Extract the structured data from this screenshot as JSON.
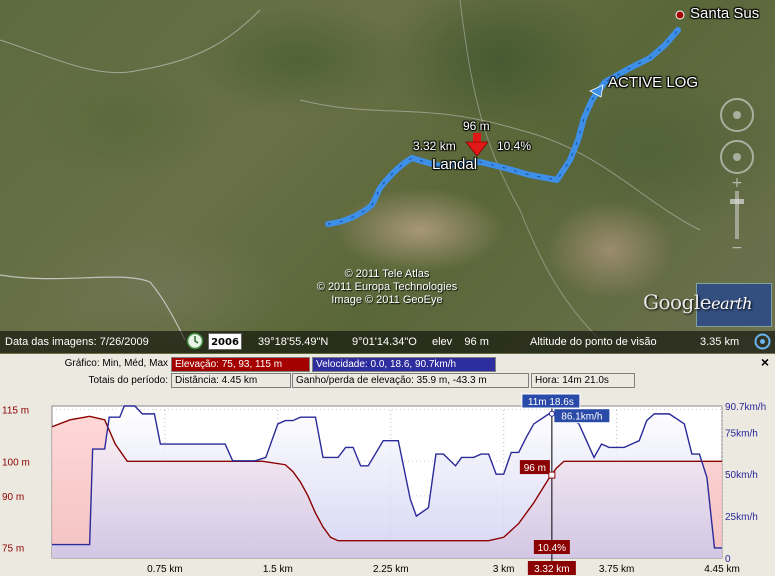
{
  "map": {
    "place_santa": "Santa Sus",
    "track_name": "ACTIVE LOG",
    "place_landal": "Landal",
    "marker_elev": "96 m",
    "marker_dist": "3.32 km",
    "marker_grade": "10.4%",
    "copyright": [
      "© 2011 Tele Atlas",
      "© 2011 Europa Technologies",
      "Image © 2011 GeoEye"
    ],
    "logo_google": "Google",
    "logo_earth": "earth",
    "track_color": "#3d8fe8"
  },
  "statusbar": {
    "image_date": "Data das imagens: 7/26/2009",
    "year": "2006",
    "lat": "39°18'55.49\"N",
    "lon": "9°01'14.34\"O",
    "elev": "elev    96 m",
    "eye_alt_label": "Altitude do ponto de visão",
    "eye_alt": "3.35 km"
  },
  "panel": {
    "grafico_label": "Gráfico: Min, Méd, Max",
    "elevation_box": "Elevação: 75, 93, 115 m",
    "speed_box": "Velocidade: 0.0, 18.6, 90.7km/h",
    "totals_label": "Totais do período:",
    "distance_box": "Distância: 4.45 km",
    "gain_box": "Ganho/perda de elevação: 35.9 m, -43.3 m",
    "time_box": "Hora: 14m 21.0s",
    "close": "×",
    "colors": {
      "elevation": "#8b0000",
      "speed": "#2a2a99",
      "elev_fill": "#f2b8b8",
      "speed_fill": "#c8c8f0"
    }
  },
  "chart_data": {
    "type": "line",
    "x_ticks": [
      "0.75 km",
      "1.5 km",
      "2.25 km",
      "3 km",
      "3.32 km",
      "3.75 km",
      "4.45 km"
    ],
    "x_tick_values": [
      0.75,
      1.5,
      2.25,
      3,
      3.32,
      3.75,
      4.45
    ],
    "y_left_ticks": [
      "115 m",
      "100 m",
      "90 m",
      "75 m"
    ],
    "y_left_tick_values": [
      115,
      100,
      90,
      75
    ],
    "y_right_ticks": [
      "90.7km/h",
      "75km/h",
      "50km/h",
      "25km/h",
      "0"
    ],
    "y_right_tick_values": [
      90.7,
      75,
      50,
      25,
      0
    ],
    "xlim": [
      0,
      4.45
    ],
    "elev_lim": [
      72,
      116
    ],
    "speed_lim": [
      0,
      90.7
    ],
    "cursor": {
      "x": 3.32,
      "time": "11m 18.6s",
      "speed": "86.1km/h",
      "elev": "96 m",
      "grade": "10.4%"
    },
    "series": [
      {
        "name": "Elevação",
        "x": [
          0,
          0.12,
          0.25,
          0.35,
          0.42,
          0.5,
          0.6,
          1.0,
          1.4,
          1.55,
          1.6,
          1.65,
          1.7,
          1.75,
          1.8,
          1.85,
          1.9,
          2.0,
          2.5,
          2.9,
          3.0,
          3.1,
          3.2,
          3.3,
          3.35,
          3.4,
          3.45,
          3.6,
          4.0,
          4.4,
          4.45
        ],
        "y": [
          110,
          112,
          113,
          112,
          105,
          100,
          100,
          100,
          100,
          99,
          97,
          94,
          90,
          85,
          81,
          78,
          77,
          77,
          77,
          77,
          78,
          82,
          88,
          95,
          98,
          100,
          100,
          100,
          100,
          100,
          100
        ]
      },
      {
        "name": "Velocidade",
        "x": [
          0,
          0.25,
          0.27,
          0.35,
          0.38,
          0.45,
          0.48,
          0.55,
          0.6,
          0.68,
          0.72,
          0.8,
          1.0,
          1.15,
          1.2,
          1.25,
          1.35,
          1.42,
          1.5,
          1.55,
          1.6,
          1.65,
          1.75,
          1.8,
          1.9,
          1.95,
          2.0,
          2.05,
          2.1,
          2.2,
          2.3,
          2.38,
          2.42,
          2.5,
          2.55,
          2.6,
          2.68,
          2.72,
          2.8,
          2.85,
          2.9,
          2.95,
          3.0,
          3.05,
          3.1,
          3.15,
          3.2,
          3.3,
          3.4,
          3.5,
          3.6,
          3.65,
          3.7,
          3.8,
          3.9,
          3.95,
          4.0,
          4.1,
          4.2,
          4.25,
          4.3,
          4.35,
          4.4,
          4.45
        ],
        "y": [
          8,
          8,
          65,
          65,
          84,
          84,
          90.7,
          90.7,
          86,
          86,
          68,
          68,
          68,
          68,
          58,
          58,
          58,
          60,
          80,
          82,
          82,
          84,
          84,
          60,
          60,
          66,
          66,
          55,
          55,
          70,
          70,
          35,
          25,
          30,
          62,
          62,
          55,
          60,
          60,
          62,
          62,
          50,
          50,
          63,
          63,
          72,
          80,
          86,
          86,
          80,
          60,
          68,
          66,
          66,
          70,
          82,
          86,
          86,
          80,
          62,
          62,
          48,
          6,
          6
        ]
      }
    ]
  }
}
